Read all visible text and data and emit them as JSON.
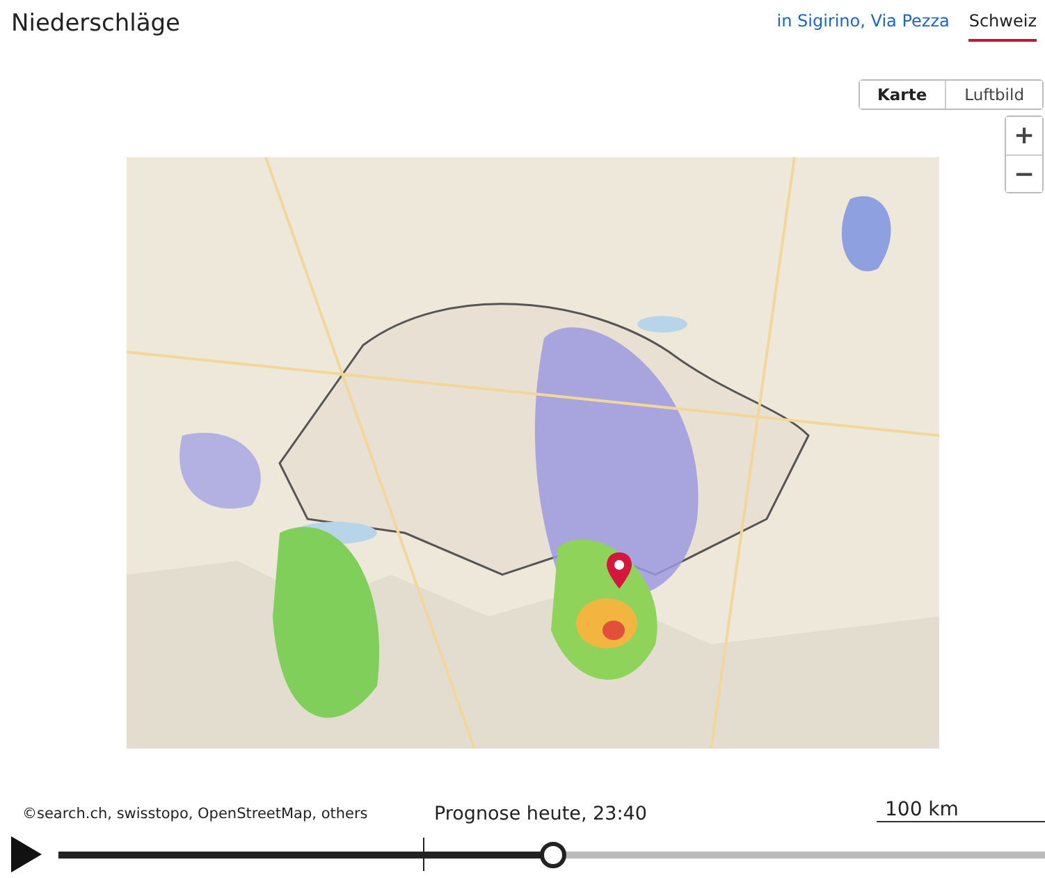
{
  "title": "Niederschläge",
  "location_tabs": [
    {
      "label": "in Sigirino, Via Pezza",
      "selected": false
    },
    {
      "label": "Schweiz",
      "selected": true
    }
  ],
  "map": {
    "view_tabs": [
      {
        "label": "Karte",
        "selected": true
      },
      {
        "label": "Luftbild",
        "selected": false
      }
    ],
    "zoom_in": "+",
    "zoom_out": "−",
    "attribution": "©search.ch, swisstopo, OpenStreetMap, others",
    "scale": "100 km"
  },
  "timeline": {
    "caption": "Prognose heute, 23:40",
    "level": 0.5
  }
}
